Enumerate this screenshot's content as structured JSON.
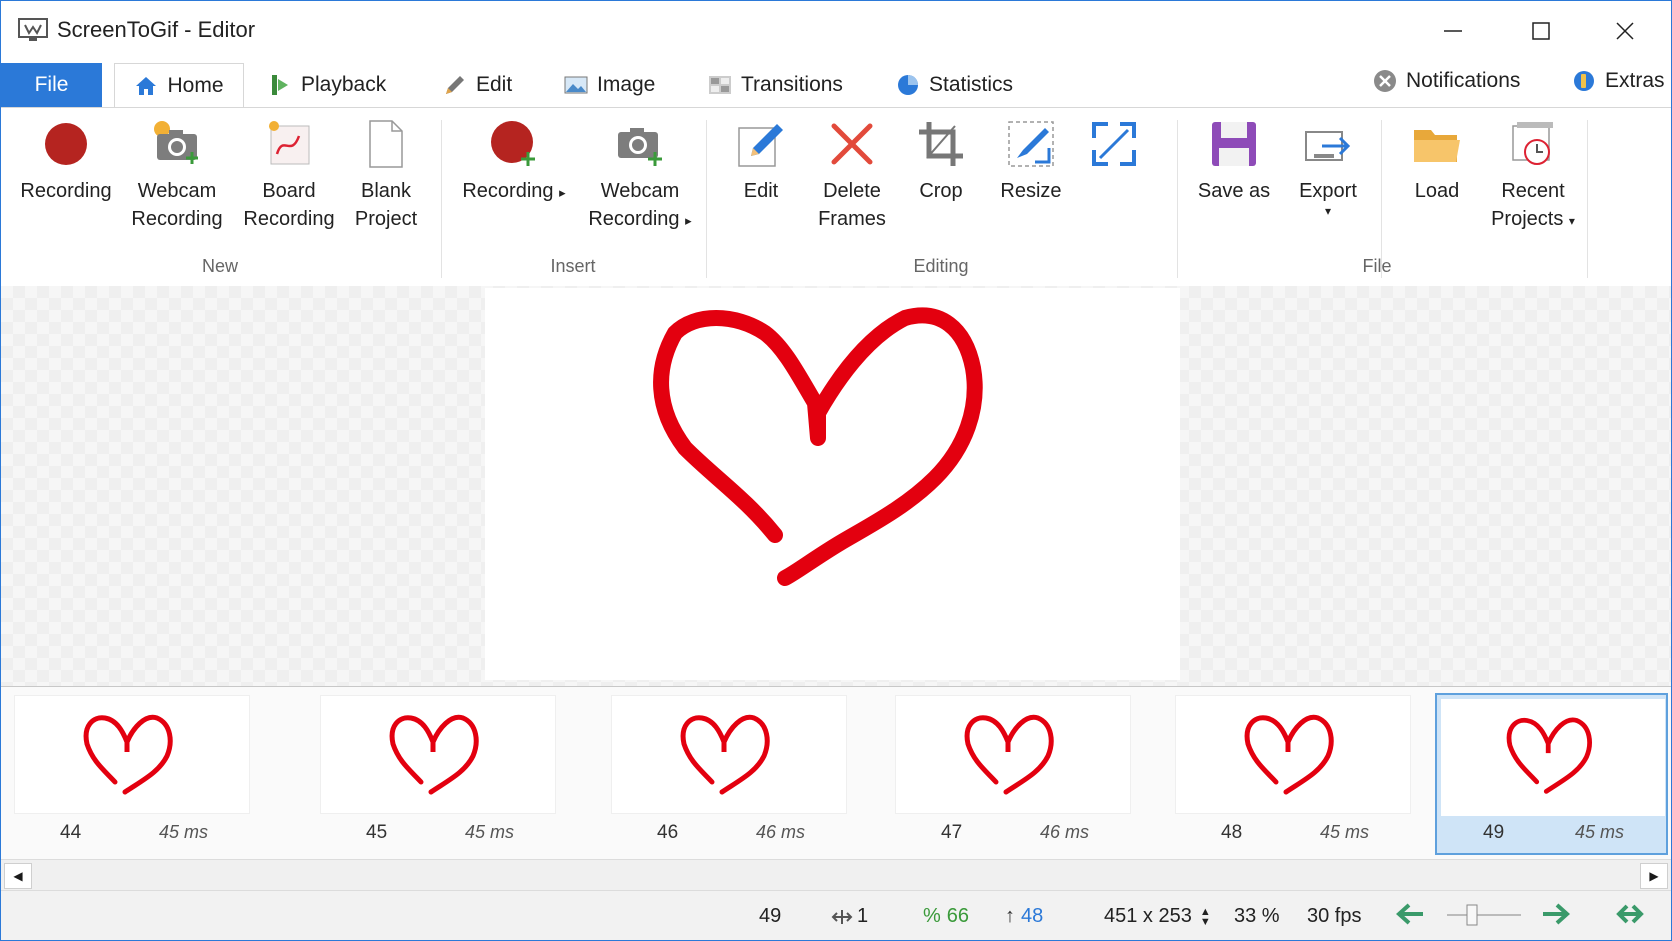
{
  "window": {
    "title": "ScreenToGif - Editor"
  },
  "tabs": {
    "file": "File",
    "home": "Home",
    "playback": "Playback",
    "edit": "Edit",
    "image": "Image",
    "transitions": "Transitions",
    "statistics": "Statistics",
    "notifications": "Notifications",
    "extras": "Extras"
  },
  "ribbon": {
    "new": {
      "label": "New",
      "recording": [
        "Recording"
      ],
      "webcam": [
        "Webcam",
        "Recording"
      ],
      "board": [
        "Board",
        "Recording"
      ],
      "blank": [
        "Blank",
        "Project"
      ]
    },
    "insert": {
      "label": "Insert",
      "recording": [
        "Recording"
      ],
      "webcam": [
        "Webcam",
        "Recording"
      ]
    },
    "editing": {
      "label": "Editing",
      "edit": [
        "Edit"
      ],
      "delete": [
        "Delete",
        "Frames"
      ],
      "crop": [
        "Crop"
      ],
      "resize": [
        "Resize"
      ]
    },
    "file": {
      "label": "File",
      "save": [
        "Save as"
      ],
      "export": [
        "Export"
      ],
      "load": [
        "Load"
      ],
      "recent": [
        "Recent",
        "Projects"
      ]
    }
  },
  "frames": [
    {
      "number": "44",
      "delay": "45 ms"
    },
    {
      "number": "45",
      "delay": "45 ms"
    },
    {
      "number": "46",
      "delay": "46 ms"
    },
    {
      "number": "47",
      "delay": "46 ms"
    },
    {
      "number": "48",
      "delay": "45 ms"
    },
    {
      "number": "49",
      "delay": "45 ms"
    }
  ],
  "selected_frame_index": 5,
  "status": {
    "frame": "49",
    "selected_count": "1",
    "percent": "66",
    "previous": "48",
    "size": "451 x 253",
    "zoom": "33 %",
    "fps": "30 fps"
  },
  "colors": {
    "accent": "#2b79d8",
    "heart": "#e3000f",
    "record": "#b52420"
  }
}
